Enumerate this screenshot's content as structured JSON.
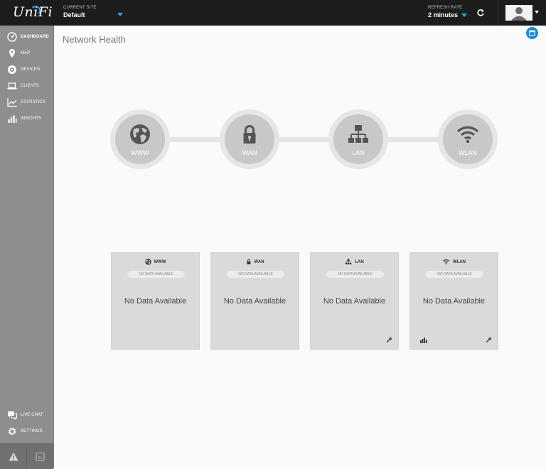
{
  "topbar": {
    "logo": "UniFi",
    "current_site_label": "CURRENT SITE",
    "current_site_value": "Default",
    "refresh_rate_label": "REFRESH RATE",
    "refresh_rate_value": "2 minutes",
    "accent_color": "#2fa5d8"
  },
  "sidebar": {
    "items": [
      {
        "label": "DASHBOARD",
        "icon": "dashboard-icon"
      },
      {
        "label": "MAP",
        "icon": "map-pin-icon"
      },
      {
        "label": "DEVICES",
        "icon": "devices-icon"
      },
      {
        "label": "CLIENTS",
        "icon": "laptop-icon"
      },
      {
        "label": "STATISTICS",
        "icon": "line-chart-icon"
      },
      {
        "label": "INSIGHTS",
        "icon": "bar-chart-icon"
      }
    ],
    "bottom_items": [
      {
        "label": "LIVE CHAT",
        "icon": "chat-icon"
      },
      {
        "label": "SETTINGS",
        "icon": "gear-icon"
      }
    ],
    "footer_icons": [
      "alert-icon",
      "calendar-icon"
    ],
    "calendar_day": "31"
  },
  "main": {
    "title": "Network Health",
    "nodes": [
      "WWW",
      "WAN",
      "LAN",
      "WLAN"
    ],
    "cards": [
      {
        "title": "WWW",
        "status": "NO DATA AVAILABLE",
        "message": "No Data Available",
        "icon": "globe-icon"
      },
      {
        "title": "WAN",
        "status": "NO DATA AVAILABLE",
        "message": "No Data Available",
        "icon": "lock-icon"
      },
      {
        "title": "LAN",
        "status": "NO DATA AVAILABLE",
        "message": "No Data Available",
        "icon": "network-icon"
      },
      {
        "title": "WLAN",
        "status": "NO DATA AVAILABLE",
        "message": "No Data Available",
        "icon": "wifi-icon"
      }
    ]
  }
}
